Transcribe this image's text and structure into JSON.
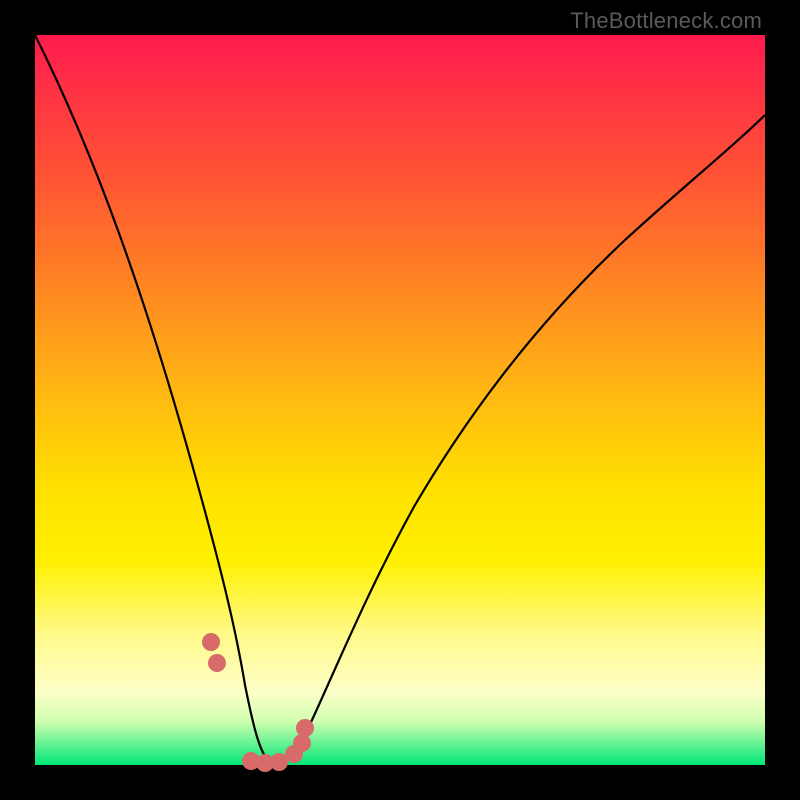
{
  "brand": "TheBottleneck.com",
  "chart_data": {
    "type": "line",
    "title": "",
    "xlabel": "",
    "ylabel": "",
    "xlim": [
      0,
      100
    ],
    "ylim": [
      0,
      100
    ],
    "grid": false,
    "legend": false,
    "series": [
      {
        "name": "bottleneck-curve",
        "x": [
          0,
          5,
          10,
          15,
          20,
          24,
          27,
          29,
          31,
          33,
          36,
          40,
          45,
          50,
          55,
          60,
          65,
          70,
          75,
          80,
          85,
          90,
          95,
          100
        ],
        "values": [
          100,
          84,
          68,
          51,
          34,
          17,
          7,
          2,
          0,
          0,
          2,
          9,
          20,
          31,
          41,
          50,
          58,
          65,
          71,
          76,
          80,
          84,
          87,
          90
        ]
      }
    ],
    "markers": {
      "name": "highlight-dots",
      "color": "#d96a6a",
      "x": [
        24.0,
        24.8,
        29.5,
        31.5,
        33.5,
        35.5,
        36.5,
        37.0
      ],
      "values": [
        17.0,
        14.0,
        0.5,
        0.3,
        0.4,
        1.5,
        3.0,
        5.0
      ]
    },
    "gradient_stops": [
      {
        "pos": 0.0,
        "color": "#ff1a4d"
      },
      {
        "pos": 0.2,
        "color": "#ff5533"
      },
      {
        "pos": 0.5,
        "color": "#ffbb11"
      },
      {
        "pos": 0.72,
        "color": "#fff000"
      },
      {
        "pos": 0.9,
        "color": "#fdffc8"
      },
      {
        "pos": 1.0,
        "color": "#00e676"
      }
    ]
  }
}
